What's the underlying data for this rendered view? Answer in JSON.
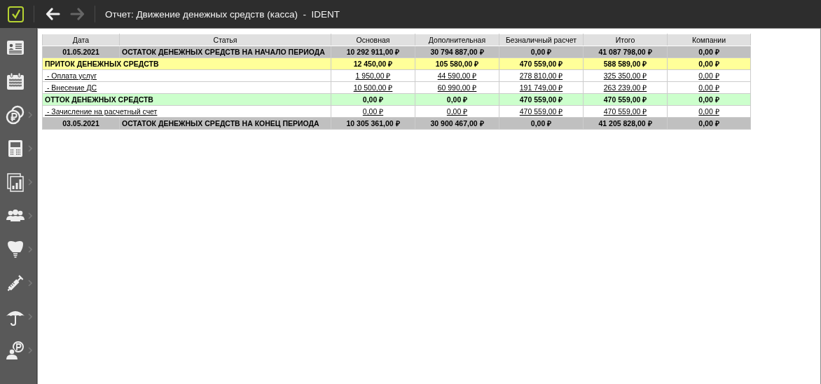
{
  "window": {
    "title": "Отчет: Движение денежных средств (касса)  -  IDENT"
  },
  "nav": {
    "back": {
      "disabled": false
    },
    "forward": {
      "disabled": true
    }
  },
  "sidebar": {
    "items": [
      {
        "submenu": false
      },
      {
        "submenu": false
      },
      {
        "submenu": true
      },
      {
        "submenu": true
      },
      {
        "submenu": true
      },
      {
        "submenu": true
      },
      {
        "submenu": true
      },
      {
        "submenu": true
      },
      {
        "submenu": true
      },
      {
        "submenu": true
      }
    ]
  },
  "table": {
    "columns": [
      "Дата",
      "Статья",
      "Основная",
      "Дополнительная",
      "Безналичный расчет",
      "Итого",
      "Компании"
    ],
    "rows": [
      {
        "kind": "balance",
        "date": "01.05.2021",
        "article": "ОСТАТОК ДЕНЕЖНЫХ СРЕДСТВ НА НАЧАЛО ПЕРИОДА",
        "values": [
          "10 292 911,00 ₽",
          "30 794 887,00 ₽",
          "0,00 ₽",
          "41 087 798,00 ₽",
          "0,00 ₽"
        ]
      },
      {
        "kind": "inflow",
        "article": "ПРИТОК ДЕНЕЖНЫХ СРЕДСТВ",
        "values": [
          "12 450,00 ₽",
          "105 580,00 ₽",
          "470 559,00 ₽",
          "588 589,00 ₽",
          "0,00 ₽"
        ]
      },
      {
        "kind": "item",
        "article": " - Оплата услуг",
        "values": [
          "1 950,00 ₽",
          "44 590,00 ₽",
          "278 810,00 ₽",
          "325 350,00 ₽",
          "0,00 ₽"
        ]
      },
      {
        "kind": "item",
        "article": " - Внесение ДС",
        "values": [
          "10 500,00 ₽",
          "60 990,00 ₽",
          "191 749,00 ₽",
          "263 239,00 ₽",
          "0,00 ₽"
        ]
      },
      {
        "kind": "outflow",
        "article": "ОТТОК ДЕНЕЖНЫХ СРЕДСТВ",
        "values": [
          "0,00 ₽",
          "0,00 ₽",
          "470 559,00 ₽",
          "470 559,00 ₽",
          "0,00 ₽"
        ]
      },
      {
        "kind": "item",
        "article": " - Зачисление на расчетный счет",
        "values": [
          "0,00 ₽",
          "0,00 ₽",
          "470 559,00 ₽",
          "470 559,00 ₽",
          "0,00 ₽"
        ]
      },
      {
        "kind": "balance",
        "date": "03.05.2021",
        "article": "ОСТАТОК ДЕНЕЖНЫХ СРЕДСТВ НА КОНЕЦ ПЕРИОДА",
        "values": [
          "10 305 361,00 ₽",
          "30 900 467,00 ₽",
          "0,00 ₽",
          "41 205 828,00 ₽",
          "0,00 ₽"
        ]
      }
    ]
  }
}
